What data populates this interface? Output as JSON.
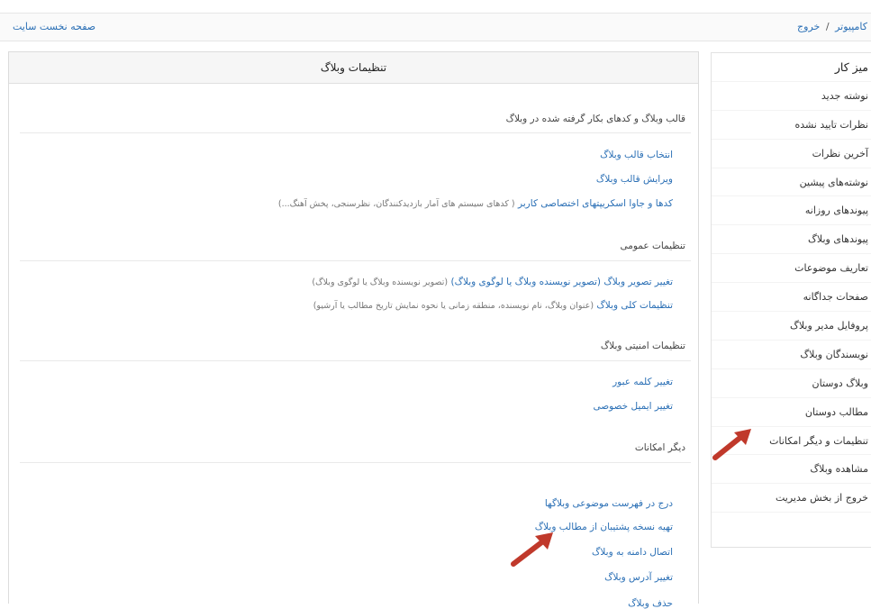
{
  "topbar": {
    "user": "کامپیوتر",
    "separator": "/",
    "logout": "خروج",
    "home": "صفحه نخست سایت"
  },
  "sidebar": {
    "items": [
      {
        "label": "میز کار"
      },
      {
        "label": "نوشته جدید"
      },
      {
        "label": "نظرات تایید نشده"
      },
      {
        "label": "آخرین نظرات"
      },
      {
        "label": "نوشته‌های پیشین"
      },
      {
        "label": "پیوندهای روزانه"
      },
      {
        "label": "پیوندهای وبلاگ"
      },
      {
        "label": "تعاریف موضوعات"
      },
      {
        "label": "صفحات جداگانه"
      },
      {
        "label": "پروفایل مدیر وبلاگ"
      },
      {
        "label": "نویسندگان وبلاگ"
      },
      {
        "label": "وبلاگ دوستان"
      },
      {
        "label": "مطالب دوستان"
      },
      {
        "label": "تنظیمات و دیگر امکانات"
      },
      {
        "label": "مشاهده وبلاگ"
      },
      {
        "label": "خروج از بخش مدیریت"
      }
    ]
  },
  "panel": {
    "title": "تنظیمات وبلاگ",
    "sections": {
      "template": {
        "title": "قالب وبلاگ و کدهای بکار گرفته شده در وبلاگ",
        "items": [
          {
            "label": "انتخاب قالب وبلاگ",
            "desc": ""
          },
          {
            "label": "ویرایش قالب وبلاگ",
            "desc": ""
          },
          {
            "label": "کدها و جاوا اسکریپتهای اختصاصی کاربر",
            "desc": "( کدهای سیستم های آمار بازدیدکنندگان، نظرسنجی، پخش آهنگ...)"
          }
        ]
      },
      "general": {
        "title": "تنظیمات عمومی",
        "items": [
          {
            "label": "تغییر تصویر وبلاگ (تصویر نویسنده وبلاگ یا لوگوی وبلاگ)",
            "desc": "(تصویر نویسنده وبلاگ یا لوگوی وبلاگ)"
          },
          {
            "label": "تنظیمات کلی وبلاگ",
            "desc": "(عنوان وبلاگ، نام نویسنده، منطقه زمانی یا نحوه نمایش تاریخ مطالب یا آرشیو)"
          }
        ]
      },
      "security": {
        "title": "تنظیمات امنیتی وبلاگ",
        "items": [
          {
            "label": "تغییر کلمه عبور"
          },
          {
            "label": "تغییر ایمیل خصوصی"
          }
        ]
      },
      "other": {
        "title": "دیگر امکانات",
        "items": [
          {
            "label": "درج در فهرست موضوعی وبلاگها"
          },
          {
            "label": "تهیه نسخه پشتیبان از مطالب وبلاگ"
          },
          {
            "label": "اتصال دامنه به وبلاگ"
          },
          {
            "label": "تغییر آدرس وبلاگ"
          },
          {
            "label": "حذف وبلاگ"
          }
        ]
      }
    }
  },
  "colors": {
    "link": "#2a6fb5",
    "arrow": "#c0392b"
  },
  "icons": [
    "arrow-icon"
  ]
}
